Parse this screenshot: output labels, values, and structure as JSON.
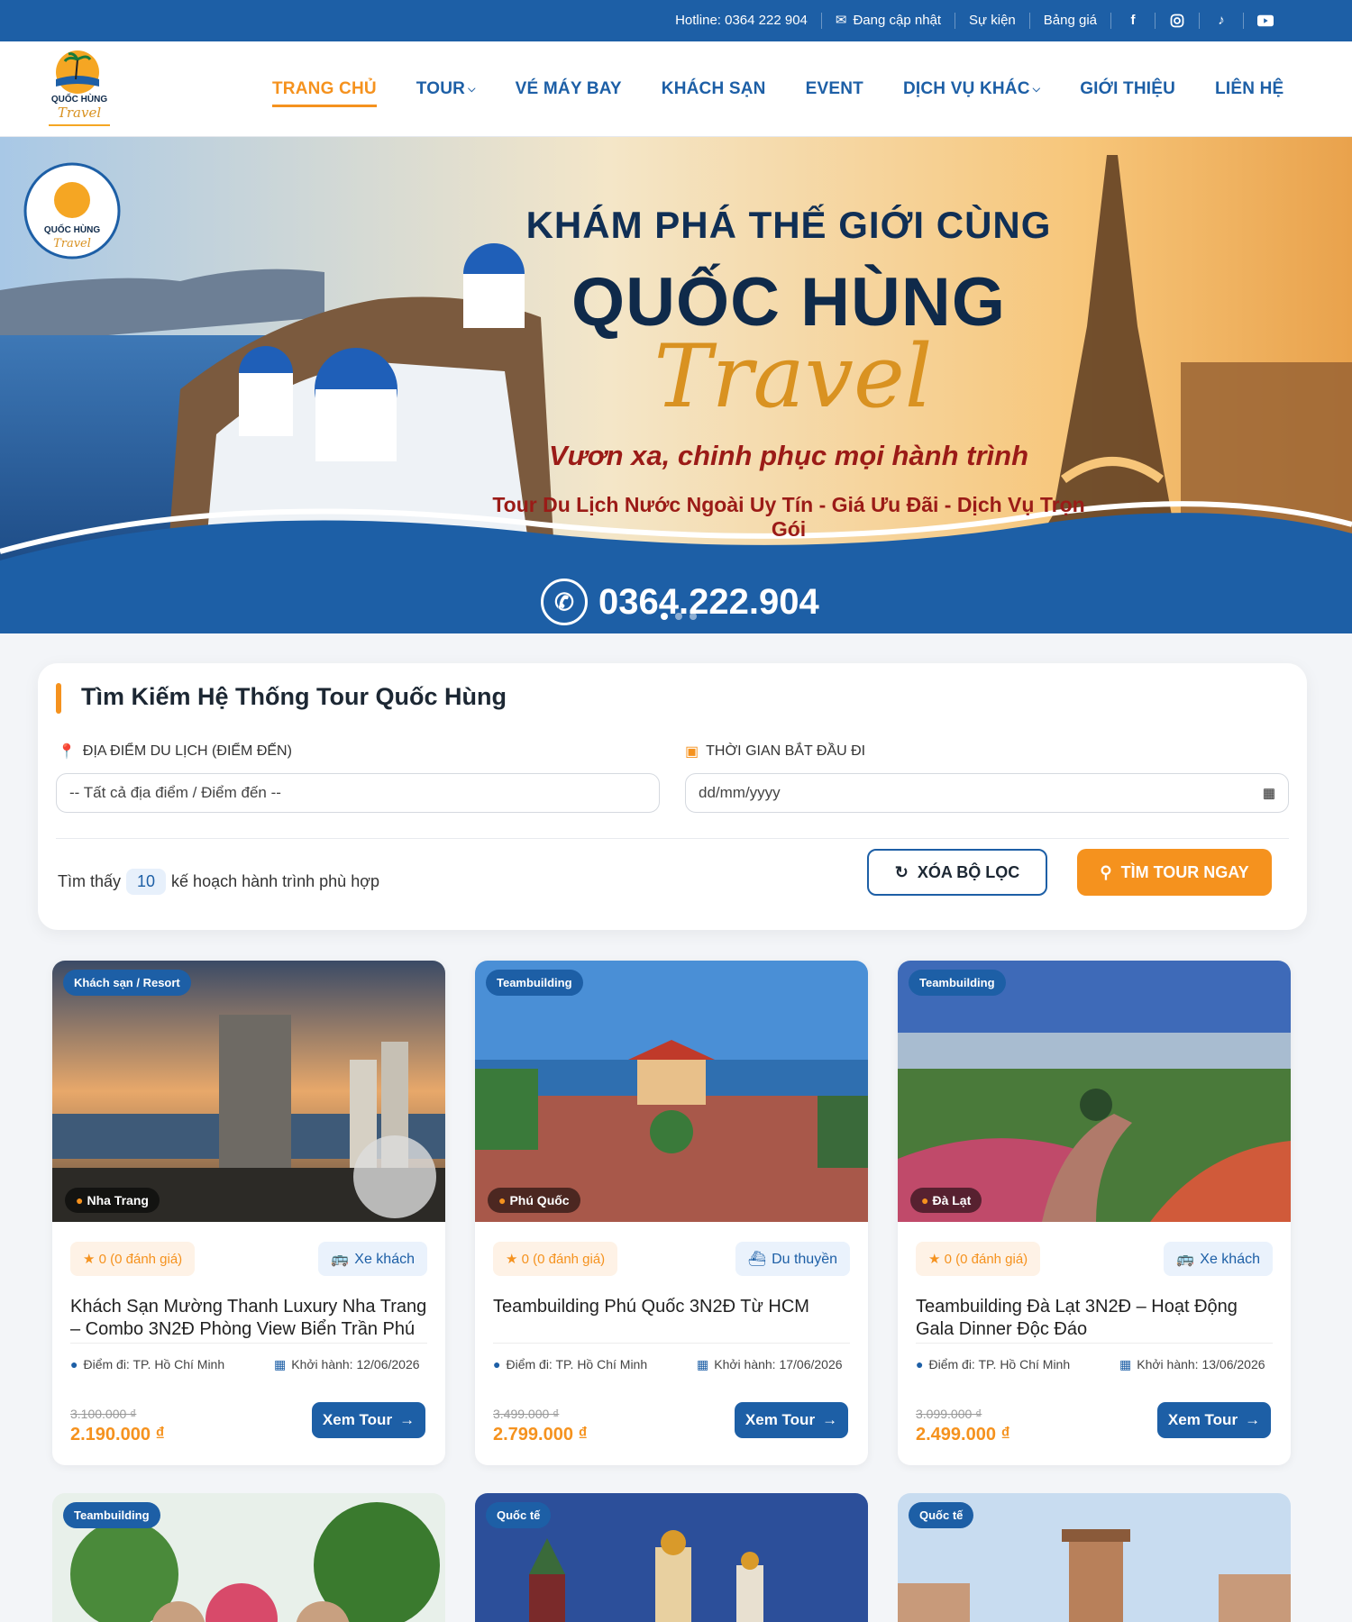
{
  "topbar": {
    "hotline": "Hotline: 0364 222 904",
    "updating": "Đang cập nhật",
    "events": "Sự kiện",
    "pricing": "Bảng giá"
  },
  "nav": {
    "home": "TRANG CHỦ",
    "tour": "TOUR",
    "flight": "VÉ MÁY BAY",
    "hotel": "KHÁCH SẠN",
    "event": "EVENT",
    "services": "DỊCH VỤ KHÁC",
    "about": "GIỚI THIỆU",
    "contact": "LIÊN HỆ"
  },
  "banner": {
    "line1": "KHÁM PHÁ THẾ GIỚI CÙNG",
    "line2": "QUỐC HÙNG",
    "line3": "Travel",
    "slogan": "Vươn xa, chinh phục mọi hành trình",
    "tagline": "Tour Du Lịch Nước Ngoài Uy Tín - Giá Ưu Đãi - Dịch Vụ Trọn Gói",
    "phone": "0364.222.904"
  },
  "search": {
    "title": "Tìm Kiếm Hệ Thống Tour Quốc Hùng",
    "dest_label": "ĐỊA ĐIỂM DU LỊCH (ĐIỂM ĐẾN)",
    "dest_value": "-- Tất cả địa điểm / Điểm đến --",
    "date_label": "THỜI GIAN BẮT ĐẦU ĐI",
    "date_placeholder": "dd/mm/yyyy",
    "found_prefix": "Tìm thấy",
    "found_count": "10",
    "found_suffix": "kế hoạch hành trình phù hợp",
    "clear_label": "XÓA BỘ LỌC",
    "find_label": "TÌM TOUR NGAY"
  },
  "cards": [
    {
      "badge": "Khách sạn / Resort",
      "location": "Nha Trang",
      "rating": "★ 0 (0 đánh giá)",
      "vehicle": "Xe khách",
      "title": "Khách Sạn Mường Thanh Luxury Nha Trang – Combo 3N2Đ Phòng View Biển Trần Phú",
      "from": "Điểm đi: TP. Hồ Chí Minh",
      "depart": "Khởi hành: 12/06/2026",
      "old_price": "3.100.000 ₫",
      "price": "2.190.000 ₫",
      "button": "Xem Tour"
    },
    {
      "badge": "Teambuilding",
      "location": "Phú Quốc",
      "rating": "★ 0 (0 đánh giá)",
      "vehicle": "Du thuyền",
      "title": "Teambuilding Phú Quốc 3N2Đ Từ HCM",
      "from": "Điểm đi: TP. Hồ Chí Minh",
      "depart": "Khởi hành: 17/06/2026",
      "old_price": "3.499.000 ₫",
      "price": "2.799.000 ₫",
      "button": "Xem Tour"
    },
    {
      "badge": "Teambuilding",
      "location": "Đà Lạt",
      "rating": "★ 0 (0 đánh giá)",
      "vehicle": "Xe khách",
      "title": "Teambuilding Đà Lạt 3N2Đ – Hoạt Động Gala Dinner Độc Đáo",
      "from": "Điểm đi: TP. Hồ Chí Minh",
      "depart": "Khởi hành: 13/06/2026",
      "old_price": "3.099.000 ₫",
      "price": "2.499.000 ₫",
      "button": "Xem Tour"
    }
  ],
  "cards_row2": [
    {
      "badge": "Teambuilding"
    },
    {
      "badge": "Quốc tế"
    },
    {
      "badge": "Quốc tế"
    }
  ],
  "colors": {
    "primary": "#1d5fa6",
    "accent": "#f5921e"
  }
}
